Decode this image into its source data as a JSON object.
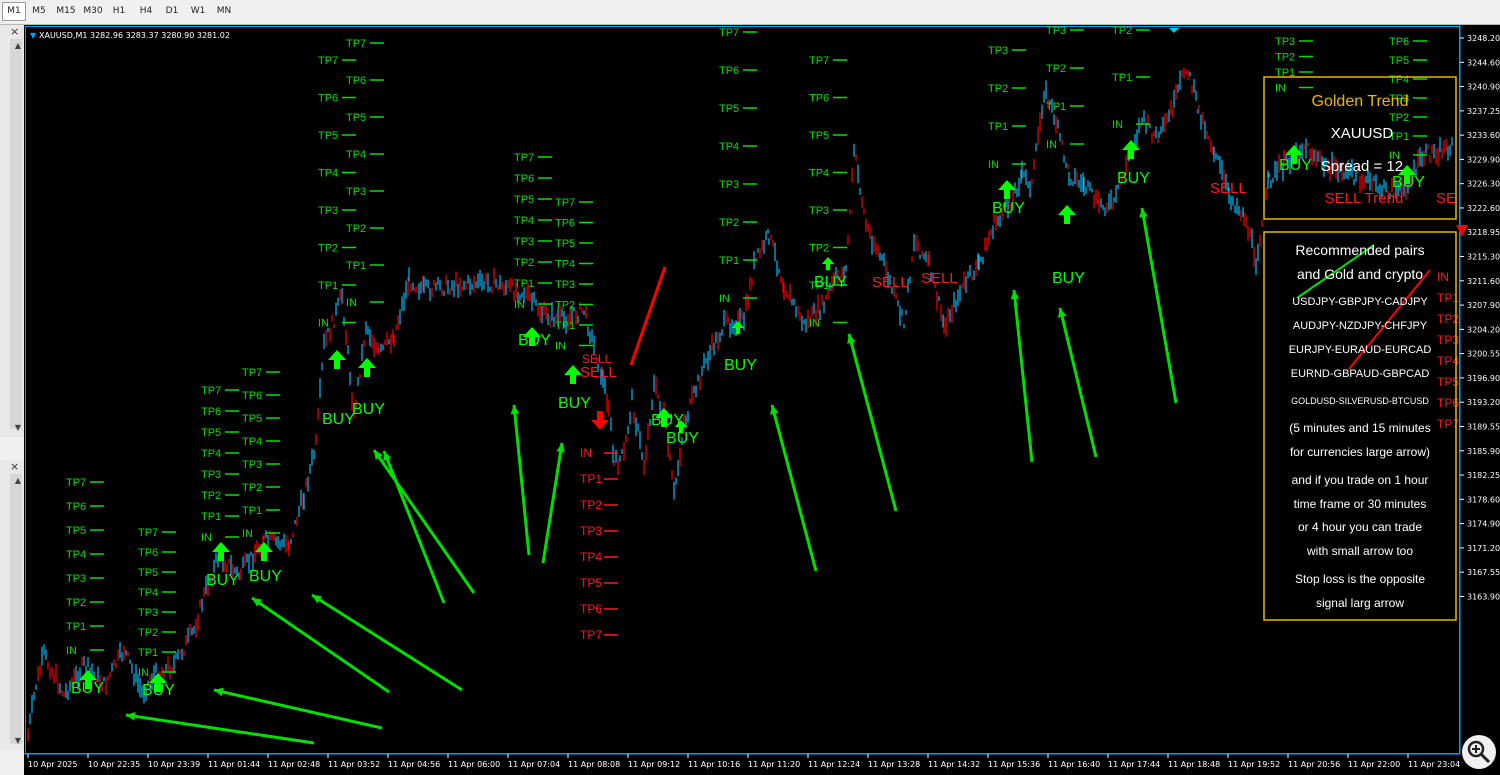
{
  "timeframes": [
    "M1",
    "M5",
    "M15",
    "M30",
    "H1",
    "H4",
    "D1",
    "W1",
    "MN"
  ],
  "active_timeframe": "M1",
  "symbol_line": "XAUUSD,M1  3282.96 3283.37 3280.90 3281.02",
  "price_axis": [
    "3248.20",
    "3244.60",
    "3240.90",
    "3237.25",
    "3233.60",
    "3229.90",
    "3226.30",
    "3222.60",
    "3218.95",
    "3215.30",
    "3211.60",
    "3207.90",
    "3204.20",
    "3200.55",
    "3196.90",
    "3193.20",
    "3189.55",
    "3185.90",
    "3182.25",
    "3178.60",
    "3174.90",
    "3171.20",
    "3167.55",
    "3163.90"
  ],
  "time_axis": [
    "10 Apr 2025",
    "10 Apr 22:35",
    "10 Apr 23:39",
    "11 Apr 01:44",
    "11 Apr 02:48",
    "11 Apr 03:52",
    "11 Apr 04:56",
    "11 Apr 06:00",
    "11 Apr 07:04",
    "11 Apr 08:08",
    "11 Apr 09:12",
    "11 Apr 10:16",
    "11 Apr 11:20",
    "11 Apr 12:24",
    "11 Apr 13:28",
    "11 Apr 14:32",
    "11 Apr 15:36",
    "11 Apr 16:40",
    "11 Apr 17:44",
    "11 Apr 18:48",
    "11 Apr 19:52",
    "11 Apr 20:56",
    "11 Apr 22:00",
    "11 Apr 23:04"
  ],
  "labels": {
    "buy": "BUY",
    "sell": "SELL",
    "in": "IN",
    "tp1": "TP1",
    "tp2": "TP2",
    "tp3": "TP3",
    "tp4": "TP4",
    "tp5": "TP5",
    "tp6": "TP6",
    "tp7": "TP7"
  },
  "info_box": {
    "title": "Golden Trend",
    "symbol": "XAUUSD",
    "spread": "Spread = 12",
    "trend": "SELL Trend"
  },
  "notes_box": {
    "line1": "Recommended pairs",
    "line2": "and Gold and crypto",
    "pairs1": "USDJPY-GBPJPY-CADJPY",
    "pairs2": "AUDJPY-NZDJPY-CHFJPY",
    "pairs3": "EURJPY-EURAUD-EURCAD",
    "pairs4": "EURND-GBPAUD-GBPCAD",
    "pairs5": "GOLDUSD-SILVERUSD-BTCUSD",
    "t1": "(5 minutes and 15 minutes",
    "t2": "for currencies large arrow)",
    "t3": "and if you trade on 1 hour",
    "t4": "time frame or 30 minutes",
    "t5": "or 4 hour you can trade",
    "t6": "with small arrow too",
    "t7": "Stop loss is the opposite",
    "t8": "signal larg arrow"
  },
  "colors": {
    "bull": "#00bfff",
    "bear": "#ff0000",
    "signal_buy": "#00e000",
    "signal_sell": "#ff1a1a",
    "box_border": "#e8b800",
    "title": "#e8b800"
  }
}
